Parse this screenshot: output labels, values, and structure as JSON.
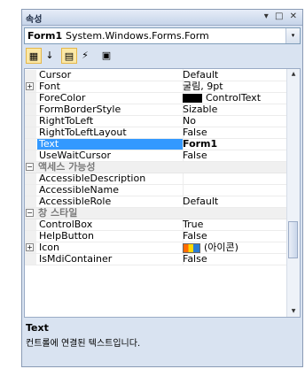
{
  "panel": {
    "title": "속성",
    "titlebar_icons": "▾ □ ✕"
  },
  "object_selector": {
    "name": "Form1",
    "type": "System.Windows.Forms.Form",
    "dropdown_icon": "▾"
  },
  "toolbar": {
    "buttons": [
      {
        "name": "categorized-view-icon",
        "glyph": "▦",
        "active": true
      },
      {
        "name": "alphabetical-sort-icon",
        "glyph": "↓",
        "active": false
      },
      {
        "name": "properties-icon",
        "glyph": "▤",
        "active": true
      },
      {
        "name": "events-icon",
        "glyph": "⚡",
        "active": false
      },
      {
        "name": "property-pages-icon",
        "glyph": "▣",
        "active": false
      }
    ]
  },
  "properties": [
    {
      "kind": "prop",
      "name": "Cursor",
      "value": "Default"
    },
    {
      "kind": "prop",
      "name": "Font",
      "value": "굴림, 9pt",
      "expander": "+"
    },
    {
      "kind": "prop",
      "name": "ForeColor",
      "value": "ControlText",
      "swatch": "black"
    },
    {
      "kind": "prop",
      "name": "FormBorderStyle",
      "value": "Sizable"
    },
    {
      "kind": "prop",
      "name": "RightToLeft",
      "value": "No"
    },
    {
      "kind": "prop",
      "name": "RightToLeftLayout",
      "value": "False"
    },
    {
      "kind": "prop",
      "name": "Text",
      "value": "Form1",
      "selected": true
    },
    {
      "kind": "prop",
      "name": "UseWaitCursor",
      "value": "False"
    },
    {
      "kind": "cat",
      "name": "액세스 가능성",
      "expander": "−"
    },
    {
      "kind": "prop",
      "name": "AccessibleDescription",
      "value": ""
    },
    {
      "kind": "prop",
      "name": "AccessibleName",
      "value": ""
    },
    {
      "kind": "prop",
      "name": "AccessibleRole",
      "value": "Default"
    },
    {
      "kind": "cat",
      "name": "창 스타일",
      "expander": "−"
    },
    {
      "kind": "prop",
      "name": "ControlBox",
      "value": "True"
    },
    {
      "kind": "prop",
      "name": "HelpButton",
      "value": "False"
    },
    {
      "kind": "prop",
      "name": "Icon",
      "value": "(아이콘)",
      "expander": "+",
      "swatch": "icon"
    },
    {
      "kind": "prop",
      "name": "IsMdiContainer",
      "value": "False"
    }
  ],
  "scrollbar": {
    "up": "▲",
    "down": "▼"
  },
  "description": {
    "title": "Text",
    "text": "컨트롤에 연결된 텍스트입니다."
  },
  "colors": {
    "selection": "#3399ff",
    "panel_bg": "#d9e3f1",
    "accent_border": "#8a9bb5"
  }
}
